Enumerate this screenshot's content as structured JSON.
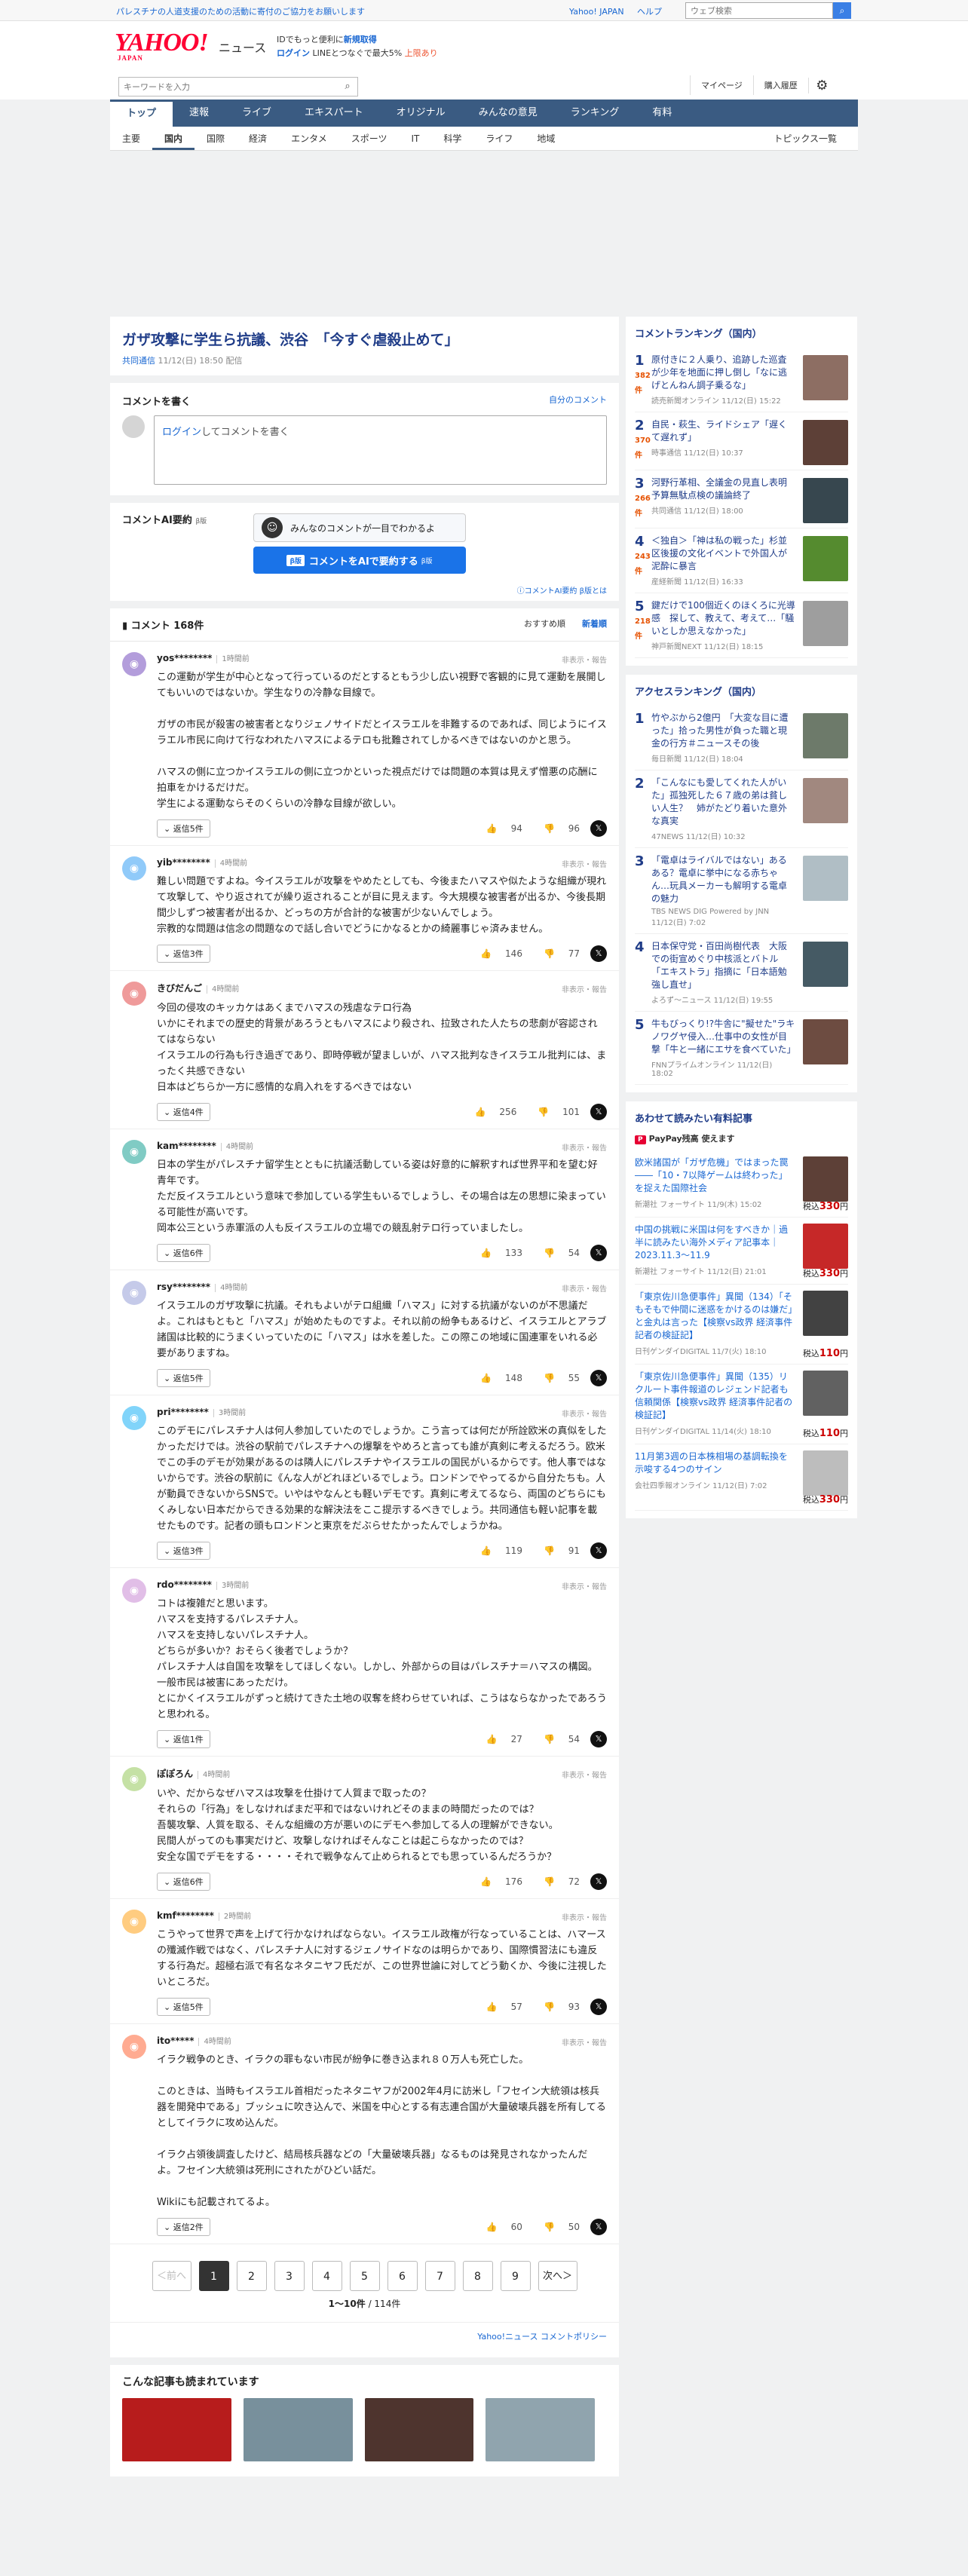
{
  "topbar": {
    "notice": "パレスチナの人道支援のための活動に寄付のご協力をお願いします",
    "links": [
      "Yahoo! JAPAN",
      "ヘルプ"
    ],
    "search_placeholder": "ウェブ検索"
  },
  "header": {
    "logo": "YAHOO!",
    "logo_sub": "JAPAN",
    "brand": "ニュース",
    "promo_line1_a": "IDでもっと便利に",
    "promo_line1_b": "新規取得",
    "promo_line2_login": "ログイン",
    "promo_line2_rest": "LINEとつなぐで最大5% ",
    "promo_line2_pt": "上限あり"
  },
  "search": {
    "placeholder": "キーワードを入力",
    "mypage": "マイページ",
    "history": "購入履歴"
  },
  "gnav": [
    "トップ",
    "速報",
    "ライブ",
    "エキスパート",
    "オリジナル",
    "みんなの意見",
    "ランキング",
    "有料"
  ],
  "cnav": [
    "主要",
    "国内",
    "国際",
    "経済",
    "エンタメ",
    "スポーツ",
    "IT",
    "科学",
    "ライフ",
    "地域"
  ],
  "cnav_right": "トピックス一覧",
  "article": {
    "title": "ガザ攻撃に学生ら抗議、渋谷　「今すぐ虐殺止めて」",
    "source": "共同通信",
    "date": "11/12(日) 18:50 配信"
  },
  "comment_form": {
    "heading": "コメントを書く",
    "my_comments": "自分のコメント",
    "login_link": "ログイン",
    "placeholder_rest": "してコメントを書く"
  },
  "ai": {
    "label": "コメントAI要約",
    "beta": "β版",
    "bubble": "みんなのコメントが一目でわかるよ",
    "button_tag": "β版",
    "button": "コメントをAIで要約する",
    "button_small": "β版",
    "about": "コメントAI要約 β版とは"
  },
  "comments_header": {
    "count": "コメント 168件",
    "sort_recommended": "おすすめ順",
    "sort_new": "新着順"
  },
  "comments": [
    {
      "user": "yos********",
      "time": "1時間前",
      "color": "#b39ddb",
      "text": "この運動が学生が中心となって行っているのだとするともう少し広い視野で客観的に見て運動を展開してもいいのではないか。学生なりの冷静な目線で。\n\nガザの市民が殺害の被害者となりジェノサイドだとイスラエルを非難するのであれば、同じようにイスラエル市民に向けて行なわれたハマスによるテロも批難されてしかるべきではないのかと思う。\n\nハマスの側に立つかイスラエルの側に立つかといった視点だけでは問題の本質は見えず憎悪の応酬に拍車をかけるだけだ。\n学生による運動ならそのくらいの冷静な目線が欲しい。",
      "replies": "返信5件",
      "likes": "94",
      "dislikes": "96"
    },
    {
      "user": "yib********",
      "time": "4時間前",
      "color": "#90caf9",
      "text": "難しい問題ですよね。今イスラエルが攻撃をやめたとしても、今後またハマスや似たような組織が現れて攻撃して、やり返されてが繰り返されることが目に見えます。今大規模な被害者が出るか、今後長期間少しずつ被害者が出るか、どっちの方が合計的な被害が少ないんでしょう。\n宗教的な問題は信念の問題なので話し合いでどうにかなるとかの綺麗事じゃ済みません。",
      "replies": "返信3件",
      "likes": "146",
      "dislikes": "77"
    },
    {
      "user": "きびだんご",
      "time": "4時間前",
      "color": "#ef9a9a",
      "text": "今回の侵攻のキッカケはあくまでハマスの残虐なテロ行為\nいかにそれまでの歴史的背景があろうともハマスにより殺され、拉致された人たちの悲劇が容認されてはならない\nイスラエルの行為も行き過ぎであり、即時停戦が望ましいが、ハマス批判なきイスラエル批判には、まったく共感できない\n日本はどちらか一方に感情的な肩入れをするべきではない",
      "replies": "返信4件",
      "likes": "256",
      "dislikes": "101"
    },
    {
      "user": "kam********",
      "time": "4時間前",
      "color": "#80cbc4",
      "text": "日本の学生がパレスチナ留学生とともに抗議活動している姿は好意的に解釈すれば世界平和を望む好青年です。\nただ反イスラエルという意味で参加している学生もいるでしょうし、その場合は左の思想に染まっている可能性が高いです。\n岡本公三という赤軍派の人も反イスラエルの立場での競乱射テロ行っていましたし。",
      "replies": "返信6件",
      "likes": "133",
      "dislikes": "54"
    },
    {
      "user": "rsy********",
      "time": "4時間前",
      "color": "#c5cae9",
      "text": "イスラエルのガザ攻撃に抗議。それもよいがテロ組織「ハマス」に対する抗議がないのが不思議だよ。これはもともと「ハマス」が始めたものですよ。それ以前の紛争もあるけど、イスラエルとアラブ諸国は比較的にうまくいっていたのに「ハマス」は水を差した。この際この地域に国連軍をいれる必要がありますね。",
      "replies": "返信5件",
      "likes": "148",
      "dislikes": "55"
    },
    {
      "user": "pri********",
      "time": "3時間前",
      "color": "#81d4fa",
      "text": "このデモにパレスチナ人は何人参加していたのでしょうか。こう言っては何だが所詮欧米の真似をしたかっただけでは。渋谷の駅前でパレスチナへの爆撃をやめろと言っても誰が真剣に考えるだろう。欧米でこの手のデモが効果があるのは隣人にパレスチナやイスラエルの国民がいるからです。他人事ではないからです。渋谷の駅前に《んな人がどれほどいるでしょう。ロンドンでやってるから自分たちも。人が動員できないからSNSで。いやはやなんとも軽いデモです。真剣に考えてるなら、両国のどちらにもくみしない日本だからできる効果的な解決法をここ提示するべきでしょう。共同通信も軽い記事を載せたものです。記者の頭もロンドンと東京をだぶらせたかったんでしょうかね。",
      "replies": "返信3件",
      "likes": "119",
      "dislikes": "91"
    },
    {
      "user": "rdo********",
      "time": "3時間前",
      "color": "#e1bee7",
      "text": "コトは複雑だと思います。\nハマスを支持するパレスチナ人。\nハマスを支持しないパレスチナ人。\nどちらが多いか？おそらく後者でしょうか？\nパレスチナ人は自国を攻撃をしてほしくない。しかし、外部からの目はパレスチナ＝ハマスの構図。一般市民は被害にあっただけ。\nとにかくイスラエルがずっと続けてきた土地の収奪を終わらせていれば、こうはならなかったであろうと思われる。",
      "replies": "返信1件",
      "likes": "27",
      "dislikes": "54"
    },
    {
      "user": "ぽぽろん",
      "time": "4時間前",
      "color": "#c5e1a5",
      "text": "いや、だからなぜハマスは攻撃を仕掛けて人質まで取ったの？\nそれらの「行為」をしなければまだ平和ではないけれどそのままの時間だったのでは？\n吾襲攻撃、人質を取る、そんな組織の方が悪いのにデモへ参加してる人の理解ができない。\n民間人がってのも事実だけど、攻撃しなければそんなことは起こらなかったのでは？\n安全な国でデモをする・・・・それで戦争なんて止められるとでも思っているんだろうか？",
      "replies": "返信6件",
      "likes": "176",
      "dislikes": "72"
    },
    {
      "user": "kmf********",
      "time": "2時間前",
      "color": "#ffcc80",
      "text": "こうやって世界で声を上げて行かなければならない。イスラエル政権が行なっていることは、ハマースの殲滅作戦ではなく、パレスチナ人に対するジェノサイドなのは明らかであり、国際慣習法にも違反する行為だ。超極右派で有名なネタニヤフ氏だが、この世界世論に対してどう動くか、今後に注視したいところだ。",
      "replies": "返信5件",
      "likes": "57",
      "dislikes": "93"
    },
    {
      "user": "ito*****",
      "time": "4時間前",
      "color": "#ffab91",
      "text": "イラク戦争のとき、イラクの罪もない市民が紛争に巻き込まれ８０万人も死亡した。\n\nこのときは、当時もイスラエル首相だったネタニヤフが2002年4月に訪米し「フセイン大統領は核兵器を開発中である」ブッシュに吹き込んで、米国を中心とする有志連合国が大量破壊兵器を所有してるとしてイラクに攻め込んだ。\n\nイラク占領後調査したけど、結局核兵器などの「大量破壊兵器」なるものは発見されなかったんだよ。フセイン大統領は死刑にされたがひどい話だ。\n\nWikiにも記載されてるよ。",
      "replies": "返信2件",
      "likes": "60",
      "dislikes": "50"
    }
  ],
  "comment_meta": {
    "flag": "非表示・報告"
  },
  "pager": {
    "prev": "＜前へ",
    "pages": [
      "1",
      "2",
      "3",
      "4",
      "5",
      "6",
      "7",
      "8",
      "9"
    ],
    "next": "次へ＞",
    "range": "1〜10件",
    "total": "/ 114件"
  },
  "policy": "Yahoo!ニュース コメントポリシー",
  "related": {
    "heading": "こんな記事も読まれています"
  },
  "side": {
    "comment_ranking": {
      "heading": "コメントランキング（国内）",
      "items": [
        {
          "num": "1",
          "count": "382",
          "unit": "件",
          "title": "原付きに２人乗り、追跡した巡査が少年を地面に押し倒し「なに逃げとんねん調子乗るな」",
          "meta": "読売新聞オンライン 11/12(日) 15:22",
          "img": "#8d6e63"
        },
        {
          "num": "2",
          "count": "370",
          "unit": "件",
          "title": "自民・萩生、ライドシェア「遅くて遅れず」",
          "meta": "時事通信 11/12(日) 10:37",
          "img": "#5d4037"
        },
        {
          "num": "3",
          "count": "266",
          "unit": "件",
          "title": "河野行革相、全議金の見直し表明　予算無駄点検の議論終了",
          "meta": "共同通信 11/12(日) 18:00",
          "img": "#37474f"
        },
        {
          "num": "4",
          "count": "243",
          "unit": "件",
          "title": "＜独自＞「神は私の戦った」杉並区後援の文化イベントで外国人が泥酔に暴言",
          "meta": "産経新聞 11/12(日) 16:33",
          "img": "#558b2f"
        },
        {
          "num": "5",
          "count": "218",
          "unit": "件",
          "title": "鍵だけで100個近くのほくろに光導感　探して、教えて、考えて…「騒いとしか思えなかった」",
          "meta": "神戸新聞NEXT 11/12(日) 18:15",
          "img": "#9e9e9e"
        }
      ]
    },
    "access_ranking": {
      "heading": "アクセスランキング（国内）",
      "items": [
        {
          "num": "1",
          "title": "竹やぶから2億円　「大変な目に遭った」拾った男性が負った職と現金の行方＃ニュースその後",
          "meta": "毎日新聞 11/12(日) 18:04",
          "img": "#6d7a6a"
        },
        {
          "num": "2",
          "title": "「こんなにも愛してくれた人がいた」孤独死した６７歳の弟は貧しい人生？　姉がたどり着いた意外な真実",
          "meta": "47NEWS 11/12(日) 10:32",
          "img": "#a1887f"
        },
        {
          "num": "3",
          "title": "「電卓はライバルではない」あるある？電卓に挙中になる赤ちゃん…玩具メーカーも解明する電卓の魅力",
          "meta": "TBS NEWS DIG Powered by JNN 11/12(日) 7:02",
          "img": "#b0bec5"
        },
        {
          "num": "4",
          "title": "日本保守党・百田尚樹代表　大阪での街宣めぐり中核派とバトル「エキストラ」指摘に「日本語勉強し直せ」",
          "meta": "よろず〜ニュース 11/12(日) 19:55",
          "img": "#455a64"
        },
        {
          "num": "5",
          "title": "牛もびっくり!?牛舎に\"擬せた\"ラキノワグヤ侵入…仕事中の女性が目撃「牛と一緒にエサを食べていた」",
          "meta": "FNNプライムオンライン 11/12(日) 18:02",
          "img": "#6d4c41"
        }
      ]
    },
    "paid": {
      "heading": "あわせて読みたい有料記事",
      "shop_tag": "P",
      "shop_label": "PayPay残高 使えます",
      "items": [
        {
          "title": "欧米諸国が「ガザ危機」ではまった罠――「10・7以降ゲームは終わった」を捉えた国際社会",
          "meta": "新潮社 フォーサイト 11/9(木) 15:02",
          "price_pre": "税込",
          "price": "330",
          "unit": "円",
          "img": "#5d4037"
        },
        {
          "title": "中国の挑戦に米国は何をすべきか｜過半に読みたい海外メディア記事本｜2023.11.3〜11.9",
          "meta": "新潮社 フォーサイト 11/12(日) 21:01",
          "price_pre": "税込",
          "price": "330",
          "unit": "円",
          "img": "#c62828"
        },
        {
          "title": "「東京佐川急便事件」異聞（134）「そもそもで仲間に迷惑をかけるのは嫌だ」と金丸は言った【検察vs政界 経済事件記者の検証記】",
          "meta": "日刊ゲンダイDIGITAL 11/7(火) 18:10",
          "price_pre": "税込",
          "price": "110",
          "unit": "円",
          "img": "#424242"
        },
        {
          "title": "「東京佐川急便事件」異聞（135）リクルート事件報道のレジェンド記者も信頼関係【検察vs政界 経済事件記者の検証記】",
          "meta": "日刊ゲンダイDIGITAL 11/14(火) 18:10",
          "price_pre": "税込",
          "price": "110",
          "unit": "円",
          "img": "#616161"
        },
        {
          "title": "11月第3週の日本株相場の基調転換を示唆する4つのサイン",
          "meta": "会社四季報オンライン 11/12(日) 7:02",
          "price_pre": "税込",
          "price": "330",
          "unit": "円",
          "img": "#bdbdbd"
        }
      ]
    }
  }
}
